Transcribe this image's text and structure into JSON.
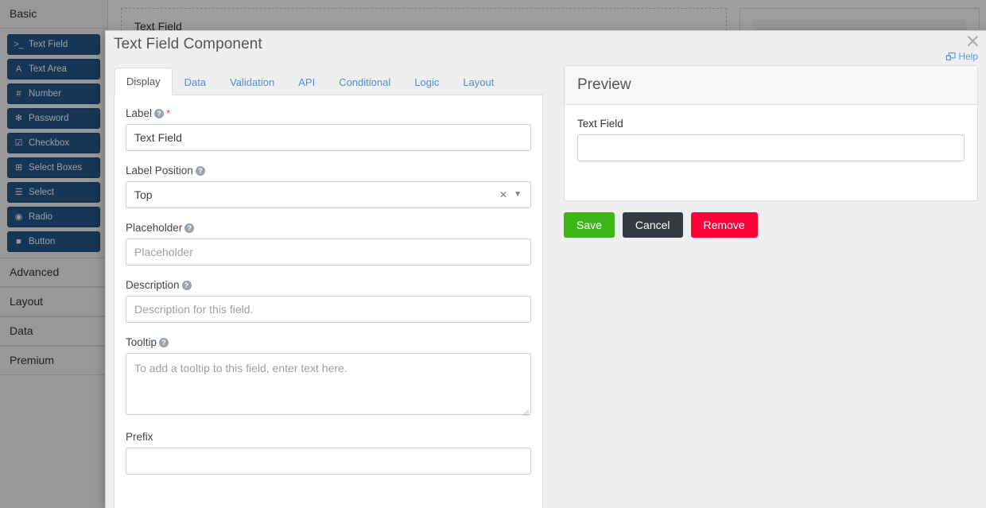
{
  "builder": {
    "sidebar": {
      "sections": [
        {
          "label": "Basic",
          "expanded": true
        },
        {
          "label": "Advanced",
          "expanded": false
        },
        {
          "label": "Layout",
          "expanded": false
        },
        {
          "label": "Data",
          "expanded": false
        },
        {
          "label": "Premium",
          "expanded": false
        }
      ],
      "basic_components": [
        {
          "label": "Text Field",
          "icon": "terminal-prompt-icon",
          "glyph": ">_"
        },
        {
          "label": "Text Area",
          "icon": "font-letter-a-icon",
          "glyph": "A"
        },
        {
          "label": "Number",
          "icon": "hash-icon",
          "glyph": "#"
        },
        {
          "label": "Password",
          "icon": "asterisk-icon",
          "glyph": "✻"
        },
        {
          "label": "Checkbox",
          "icon": "checkbox-checked-icon",
          "glyph": "☑"
        },
        {
          "label": "Select Boxes",
          "icon": "plus-square-icon",
          "glyph": "⊞"
        },
        {
          "label": "Select",
          "icon": "list-icon",
          "glyph": "☰"
        },
        {
          "label": "Radio",
          "icon": "radio-button-icon",
          "glyph": "◉"
        },
        {
          "label": "Button",
          "icon": "square-icon",
          "glyph": "■"
        }
      ]
    },
    "canvas": {
      "field_label": "Text Field"
    }
  },
  "modal": {
    "title": "Text Field Component",
    "close_icon": "close-icon",
    "close_glyph": "✕",
    "help_label": "Help",
    "help_icon": "external-window-icon",
    "tabs": [
      {
        "label": "Display",
        "active": true
      },
      {
        "label": "Data",
        "active": false
      },
      {
        "label": "Validation",
        "active": false
      },
      {
        "label": "API",
        "active": false
      },
      {
        "label": "Conditional",
        "active": false
      },
      {
        "label": "Logic",
        "active": false
      },
      {
        "label": "Layout",
        "active": false
      }
    ],
    "display_form": {
      "label_field": {
        "label": "Label",
        "value": "Text Field",
        "required_marker": "*",
        "has_help": true
      },
      "label_position": {
        "label": "Label Position",
        "value": "Top",
        "clear_glyph": "✕",
        "caret_glyph": "▼",
        "has_help": true
      },
      "placeholder": {
        "label": "Placeholder",
        "value": "",
        "placeholder": "Placeholder",
        "has_help": true
      },
      "description": {
        "label": "Description",
        "value": "",
        "placeholder": "Description for this field.",
        "has_help": true
      },
      "tooltip": {
        "label": "Tooltip",
        "value": "",
        "placeholder": "To add a tooltip to this field, enter text here.",
        "has_help": true
      },
      "prefix": {
        "label": "Prefix",
        "value": "",
        "placeholder": "",
        "has_help": false
      }
    },
    "preview": {
      "heading": "Preview",
      "field_label": "Text Field",
      "field_value": "",
      "field_placeholder": ""
    },
    "buttons": {
      "save": "Save",
      "cancel": "Cancel",
      "remove": "Remove"
    }
  },
  "colors": {
    "tab_link": "#4a90e2",
    "save": "#3fb618",
    "cancel": "#343a40",
    "remove": "#ff0039",
    "component_button": "#24578f",
    "required": "#ff3333",
    "help_link": "#5b9bd5"
  }
}
